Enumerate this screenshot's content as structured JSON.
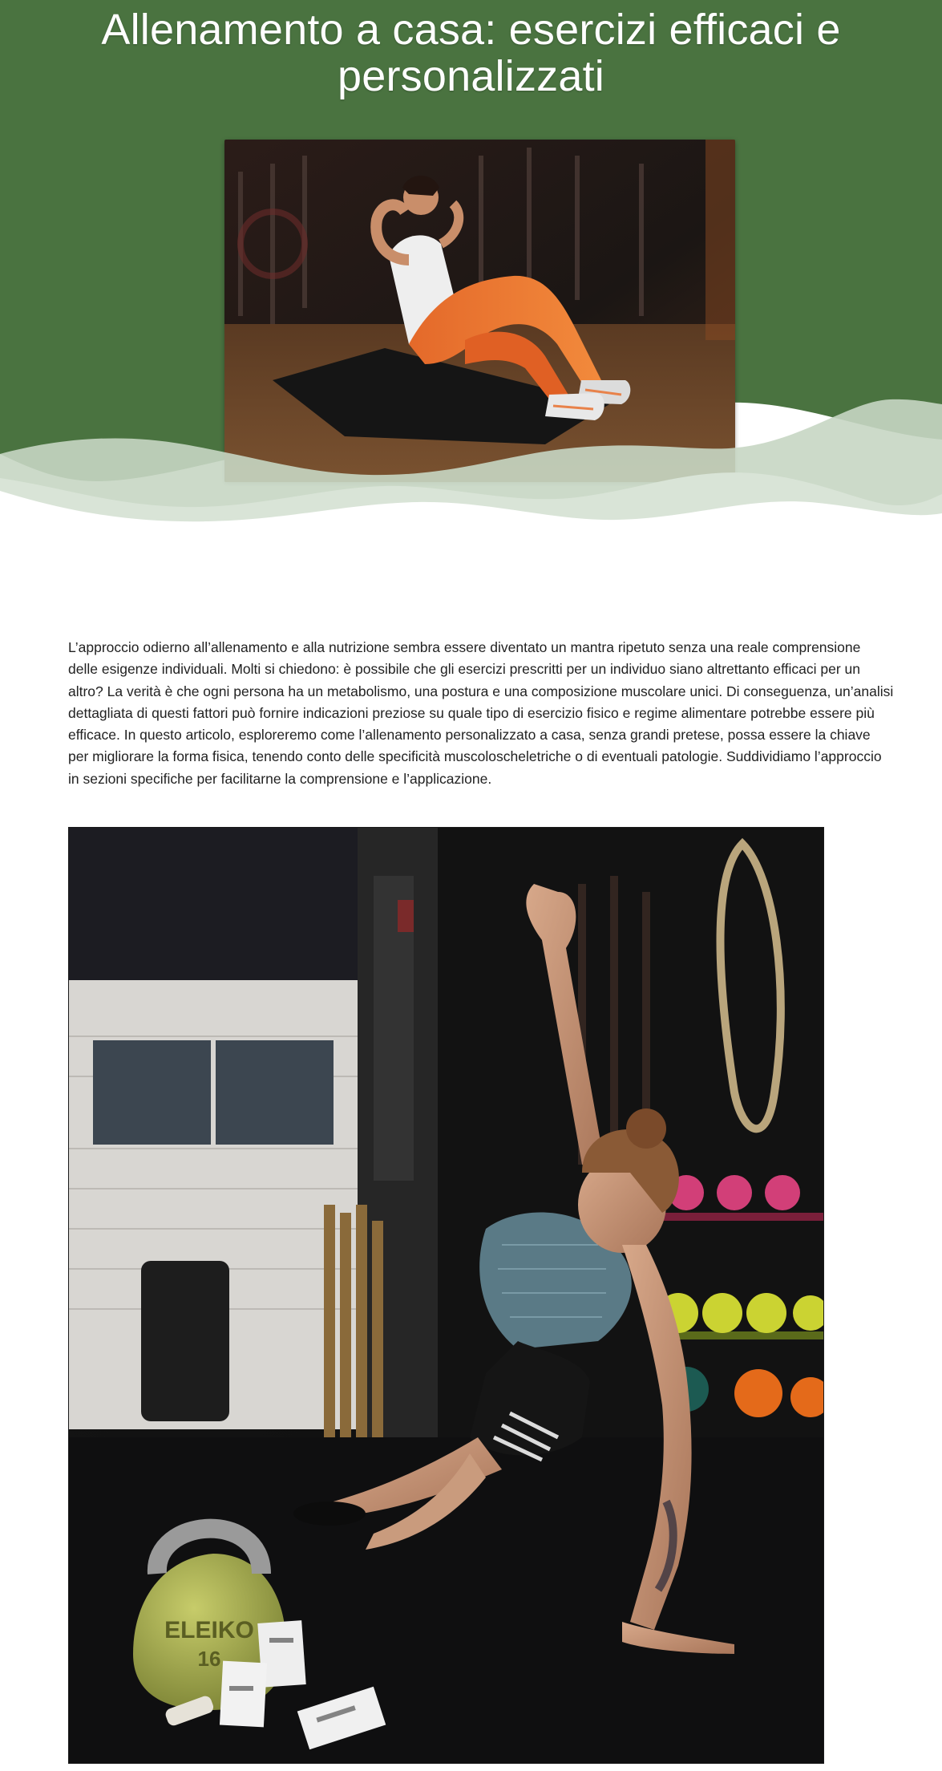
{
  "page": {
    "title": "Allenamento a casa: esercizi efficaci e personalizzati"
  },
  "article": {
    "intro": "L’approccio odierno all’allenamento e alla nutrizione sembra essere diventato un mantra ripetuto senza una reale comprensione delle esigenze individuali. Molti si chiedono: è possibile che gli esercizi prescritti per un individuo siano altrettanto efficaci per un altro? La verità è che ogni persona ha un metabolismo, una postura e una composizione muscolare unici. Di conseguenza, un’analisi dettagliata di questi fattori può fornire indicazioni preziose su quale tipo di esercizio fisico e regime alimentare potrebbe essere più efficace. In questo articolo, esploreremo come l’allenamento personalizzato a casa, senza grandi pretese, possa essere la chiave per migliorare la forma fisica, tenendo conto delle specificità muscoloscheletriche o di eventuali patologie. Suddividiamo l’approccio in sezioni specifiche per facilitarne la comprensione e l’applicazione."
  },
  "images": {
    "hero_photo_text": "",
    "kettlebell_text": "ELEIKO",
    "kettlebell_number": "16"
  },
  "colors": {
    "header_green": "#4a7340",
    "wave_light": "#d9e4d7",
    "wave_mid": "#c6d6c3",
    "text": "#222222",
    "background": "#ffffff"
  }
}
